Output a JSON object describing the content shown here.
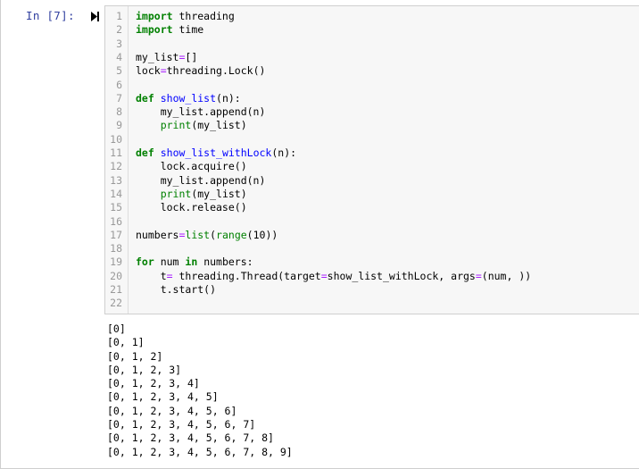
{
  "cell": {
    "prompt": "In  [7]:",
    "run_icon": "run-cell-icon"
  },
  "code_lines": [
    {
      "num": "1",
      "tokens": [
        {
          "t": "import",
          "c": "kw"
        },
        {
          "t": " threading",
          "c": ""
        }
      ]
    },
    {
      "num": "2",
      "tokens": [
        {
          "t": "import",
          "c": "kw"
        },
        {
          "t": " time",
          "c": ""
        }
      ]
    },
    {
      "num": "3",
      "tokens": []
    },
    {
      "num": "4",
      "tokens": [
        {
          "t": "my_list",
          "c": ""
        },
        {
          "t": "=",
          "c": "op"
        },
        {
          "t": "[]",
          "c": ""
        }
      ]
    },
    {
      "num": "5",
      "tokens": [
        {
          "t": "lock",
          "c": ""
        },
        {
          "t": "=",
          "c": "op"
        },
        {
          "t": "threading.Lock()",
          "c": ""
        }
      ]
    },
    {
      "num": "6",
      "tokens": []
    },
    {
      "num": "7",
      "tokens": [
        {
          "t": "def",
          "c": "kw"
        },
        {
          "t": " ",
          "c": ""
        },
        {
          "t": "show_list",
          "c": "fn"
        },
        {
          "t": "(n):",
          "c": ""
        }
      ]
    },
    {
      "num": "8",
      "tokens": [
        {
          "t": "    my_list.append(n)",
          "c": ""
        }
      ]
    },
    {
      "num": "9",
      "tokens": [
        {
          "t": "    ",
          "c": ""
        },
        {
          "t": "print",
          "c": "bi"
        },
        {
          "t": "(my_list)",
          "c": ""
        }
      ]
    },
    {
      "num": "10",
      "tokens": []
    },
    {
      "num": "11",
      "tokens": [
        {
          "t": "def",
          "c": "kw"
        },
        {
          "t": " ",
          "c": ""
        },
        {
          "t": "show_list_withLock",
          "c": "fn"
        },
        {
          "t": "(n):",
          "c": ""
        }
      ]
    },
    {
      "num": "12",
      "tokens": [
        {
          "t": "    lock.acquire()",
          "c": ""
        }
      ]
    },
    {
      "num": "13",
      "tokens": [
        {
          "t": "    my_list.append(n)",
          "c": ""
        }
      ]
    },
    {
      "num": "14",
      "tokens": [
        {
          "t": "    ",
          "c": ""
        },
        {
          "t": "print",
          "c": "bi"
        },
        {
          "t": "(my_list)",
          "c": ""
        }
      ]
    },
    {
      "num": "15",
      "tokens": [
        {
          "t": "    lock.release()",
          "c": ""
        }
      ]
    },
    {
      "num": "16",
      "tokens": []
    },
    {
      "num": "17",
      "tokens": [
        {
          "t": "numbers",
          "c": ""
        },
        {
          "t": "=",
          "c": "op"
        },
        {
          "t": "list",
          "c": "bi"
        },
        {
          "t": "(",
          "c": ""
        },
        {
          "t": "range",
          "c": "bi"
        },
        {
          "t": "(10))",
          "c": ""
        }
      ]
    },
    {
      "num": "18",
      "tokens": []
    },
    {
      "num": "19",
      "tokens": [
        {
          "t": "for",
          "c": "kw"
        },
        {
          "t": " num ",
          "c": ""
        },
        {
          "t": "in",
          "c": "kw"
        },
        {
          "t": " numbers:",
          "c": ""
        }
      ]
    },
    {
      "num": "20",
      "tokens": [
        {
          "t": "    t",
          "c": ""
        },
        {
          "t": "=",
          "c": "op"
        },
        {
          "t": " threading.Thread(target",
          "c": ""
        },
        {
          "t": "=",
          "c": "op"
        },
        {
          "t": "show_list_withLock, args",
          "c": ""
        },
        {
          "t": "=",
          "c": "op"
        },
        {
          "t": "(num, ))",
          "c": ""
        }
      ]
    },
    {
      "num": "21",
      "tokens": [
        {
          "t": "    t.start()",
          "c": ""
        }
      ]
    },
    {
      "num": "22",
      "tokens": []
    }
  ],
  "output_lines": [
    "[0]",
    "[0, 1]",
    "[0, 1, 2]",
    "[0, 1, 2, 3]",
    "[0, 1, 2, 3, 4]",
    "[0, 1, 2, 3, 4, 5]",
    "[0, 1, 2, 3, 4, 5, 6]",
    "[0, 1, 2, 3, 4, 5, 6, 7]",
    "[0, 1, 2, 3, 4, 5, 6, 7, 8]",
    "[0, 1, 2, 3, 4, 5, 6, 7, 8, 9]"
  ],
  "colors": {
    "prompt": "#303f9f",
    "keyword": "#008000",
    "function_name": "#0000ff",
    "builtin": "#008000",
    "operator": "#aa22ff",
    "input_background": "#f7f7f7"
  }
}
